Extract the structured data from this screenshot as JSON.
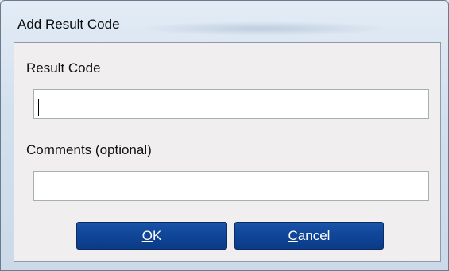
{
  "window": {
    "title": "Add Result Code"
  },
  "form": {
    "result_code": {
      "label": "Result Code",
      "value": ""
    },
    "comments": {
      "label": "Comments (optional)",
      "value": ""
    }
  },
  "buttons": {
    "ok": {
      "mnemonic": "O",
      "rest": "K"
    },
    "cancel": {
      "mnemonic": "C",
      "rest": "ancel"
    }
  },
  "colors": {
    "button_bg": "#0f4597",
    "client_bg": "#f0eeee"
  }
}
